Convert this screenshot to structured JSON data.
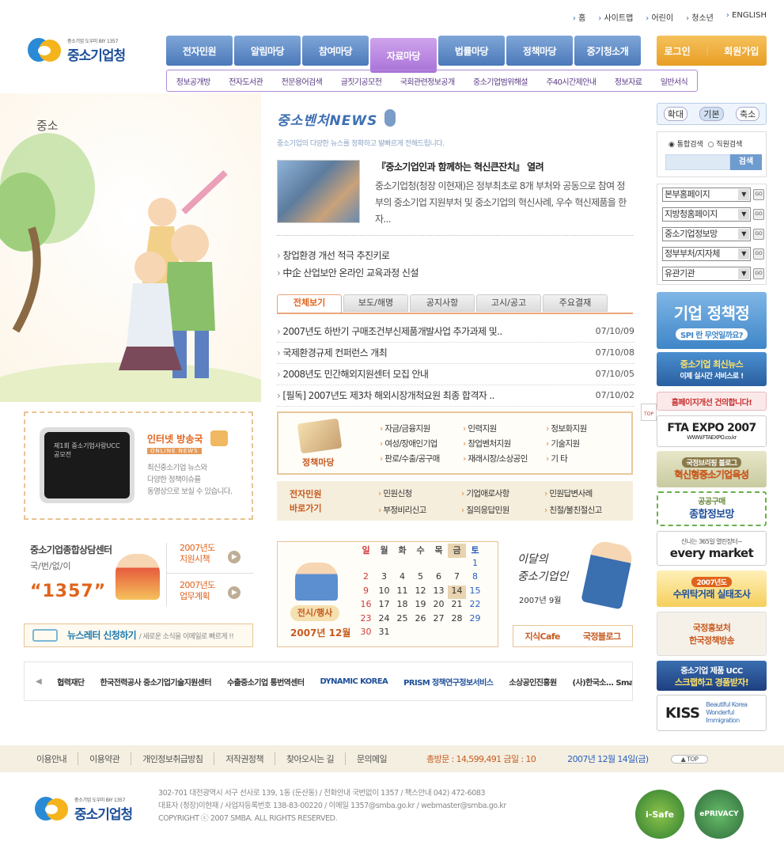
{
  "util": [
    "홈",
    "사이트맵",
    "어린이",
    "청소년",
    "ENGLISH"
  ],
  "logo": {
    "small": "중소기업 도우미 BIY 1357",
    "name": "중소기업청"
  },
  "gnb": [
    "전자민원",
    "알림마당",
    "참여마당",
    "자료마당",
    "법률마당",
    "정책마당",
    "중기청소개"
  ],
  "login": {
    "login": "로그인",
    "join": "회원가입"
  },
  "subnav": [
    "정보공개방",
    "전자도서관",
    "전문용어검색",
    "글짓기공모전",
    "국회관련정보공개",
    "중소기업범위해설",
    "주40시간제안내",
    "정보자료",
    "일반서식"
  ],
  "page_title": "중소",
  "news": {
    "title": "중소벤처NEWS",
    "subtitle": "중소기업의 다양한 뉴스를 정확하고 발빠르게 전해드립니다.",
    "headline": "『중소기업인과 함께하는 혁신큰잔치』 열려",
    "body": "중소기업청(청장 이현재)은 정부최초로 8개 부처와 공동으로 참여 정부의 중소기업 지원부처 및 중소기업의 혁신사례, 우수 혁신제품을 한자...",
    "quick": [
      "창업환경 개선 적극 추진키로",
      "中企 산업보안 온라인 교육과정 신설"
    ]
  },
  "tabs": [
    "전체보기",
    "보도/해명",
    "공지사항",
    "고시/공고",
    "주요결재"
  ],
  "board": [
    {
      "title": "2007년도 하반기 구매조건부신제품개발사업 추가과제 및..",
      "date": "07/10/09"
    },
    {
      "title": "국제환경규제 컨퍼런스 개최",
      "date": "07/10/08"
    },
    {
      "title": "2008년도 민간해외지원센터 모집 안내",
      "date": "07/10/05"
    },
    {
      "title": "[필독] 2007년도 제3차 해외시장개척요원 최종 합격자 ..",
      "date": "07/10/02"
    }
  ],
  "policy": {
    "title": "정책마당",
    "items": [
      "자금/금융지원",
      "인력지원",
      "정보화지원",
      "여성/장애인기업",
      "창업벤처지원",
      "기술지원",
      "판로/수출/공구매",
      "재래시장/소상공인",
      "기 타"
    ]
  },
  "civil": {
    "title1": "전자민원",
    "title2": "바로가기",
    "items": [
      "민원신청",
      "기업애로사항",
      "민원답변사례",
      "부정비리신고",
      "질의응답민원",
      "친절/불친절신고"
    ]
  },
  "broadcast": {
    "title": "인터넷 방송국",
    "tag": "ONLINE NEWS",
    "desc1": "최신중소기업 뉴스와",
    "desc2": "다양한 정책이슈를",
    "desc3": "동영상으로 보실 수 있습니다.",
    "screen": "제1회 중소기업사랑UCC 공모전"
  },
  "consult": {
    "t1": "중소기업종합상담센터",
    "t2": "국/번/없/이",
    "t3": "“1357”",
    "links": [
      "2007년도 지원시책",
      "2007년도 업무계획"
    ]
  },
  "newsletter": {
    "label": "뉴스레터 신청하기",
    "sub": "/ 새로운 소식을 이메일로 빠르게 !!"
  },
  "calendar": {
    "event": "전시/행사",
    "month": "2007년 12월",
    "head": [
      "일",
      "월",
      "화",
      "수",
      "목",
      "금",
      "토"
    ],
    "rows": [
      [
        "",
        "",
        "",
        "",
        "",
        "",
        "1"
      ],
      [
        "2",
        "3",
        "4",
        "5",
        "6",
        "7",
        "8"
      ],
      [
        "9",
        "10",
        "11",
        "12",
        "13",
        "14",
        "15"
      ],
      [
        "16",
        "17",
        "18",
        "19",
        "20",
        "21",
        "22"
      ],
      [
        "23",
        "24",
        "25",
        "26",
        "27",
        "28",
        "29"
      ],
      [
        "30",
        "31",
        "",
        "",
        "",
        "",
        ""
      ]
    ],
    "today": "14"
  },
  "man_of_month": {
    "title1": "이달의",
    "title2": "중소기업인",
    "month": "2007년 9월"
  },
  "cafe": [
    "지식Cafe",
    "국정블로그"
  ],
  "partners": [
    "협력재단",
    "한국전력공사 중소기업기술지원센터",
    "수출중소기업 통번역센터",
    "DYNAMIC KOREA",
    "PRISM 정책연구정보서비스",
    "소상공인진흥원",
    "(사)한국소... Small Busines"
  ],
  "right": {
    "size": [
      "확대",
      "기본",
      "축소"
    ],
    "search_opts": [
      "통합검색",
      "직원검색"
    ],
    "search_btn": "검색",
    "selects": [
      "본부홈페이지",
      "지방청홈페이지",
      "중소기업정보망",
      "정부부처/지자체",
      "유관기관"
    ],
    "go": "GO",
    "banners": [
      {
        "label": "기업 정책정",
        "sub": "SPI 란 무엇일까요?"
      },
      {
        "label": "중소기업 최신뉴스",
        "sub": "이제 실시간 서비스로 !"
      },
      {
        "label": "홈페이지개선 건의합니다!"
      },
      {
        "label": "FTA EXPO 2007",
        "sub": "WWW.FTAEXPO.co.kr"
      },
      {
        "label": "국정브리핑 블로그",
        "sub": "혁신형중소기업육성"
      },
      {
        "label": "공공구매",
        "sub": "종합정보망"
      },
      {
        "label": "every market",
        "sub": "신나는 365일 열린장터~"
      },
      {
        "label": "2007년도",
        "sub": "수위탁거래 실태조사"
      },
      {
        "label": "국정홍보처",
        "sub": "한국정책방송"
      },
      {
        "label": "중소기업 제품 UCC",
        "sub": "스크랩하고 경품받자!"
      },
      {
        "label": "KISS",
        "sub": "Beautiful Korea Wonderful Immigration"
      }
    ]
  },
  "top": "TOP",
  "footer": {
    "links": [
      "이용안내",
      "이용약관",
      "개인정보취급방침",
      "저작권정책",
      "찾아오시는 길",
      "문의메일"
    ],
    "visit": "총방문 : 14,599,491  금일 : 10",
    "date": "2007년 12월 14일(금)",
    "top": "▲ TOP",
    "addr": "302-701 대전광역시 서구 선사로 139, 1동 (둔산동) / 전화안내 국번없이 1357 / 팩스안내 042) 472-6083",
    "ceo": "대표자 (청장)이현재 / 사업자등록번호 138-83-00220 / 이메일 1357@smba.go.kr / webmaster@smba.go.kr",
    "copy": "COPYRIGHT ⓒ 2007 SMBA. ALL RIGHTS RESERVED.",
    "seals": [
      "i-Safe",
      "ePRIVACY"
    ]
  },
  "colors": {
    "brand": "#1e4f99",
    "accent": "#e0631c",
    "menu": "#4b79b9",
    "menu_on": "#a872d8"
  }
}
